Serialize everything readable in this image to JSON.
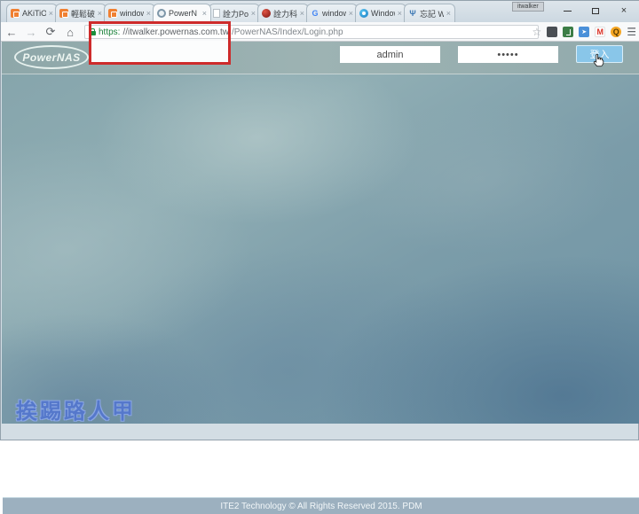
{
  "window": {
    "tooltip_label": "itwalker",
    "close_glyph": "×"
  },
  "glyphs": {
    "tab_close": "×",
    "back": "←",
    "forward": "→",
    "refresh": "⟳",
    "home": "⌂",
    "star": "☆",
    "menu": "☰",
    "gmail_m": "M",
    "q_letter": "Q",
    "google_g": "G",
    "trident": "Ψ"
  },
  "tabs": [
    {
      "title": "AKiTiO N",
      "icon": "xuite-orange"
    },
    {
      "title": "輕鬆破解",
      "icon": "xuite-orange"
    },
    {
      "title": "windows",
      "icon": "xuite-orange"
    },
    {
      "title": "PowerN",
      "icon": "powernas",
      "active": true
    },
    {
      "title": "詮力Pow",
      "icon": "blank-page"
    },
    {
      "title": "詮力科技",
      "icon": "red-sphere"
    },
    {
      "title": "windows",
      "icon": "google-g"
    },
    {
      "title": "Window",
      "icon": "blue-circle"
    },
    {
      "title": "忘記 Win",
      "icon": "trident"
    }
  ],
  "omnibox": {
    "scheme": "https:",
    "host": "//itwalker.powernas.com.tw",
    "path": "/PowerNAS/Index/Login.php"
  },
  "login_bar": {
    "logo": "PowerNAS",
    "username_value": "admin",
    "password_value": "•••••",
    "login_button": "登入"
  },
  "content": {
    "watermark": "挨踢路人甲",
    "footer": "ITE2 Technology © All Rights Reserved 2015. PDM"
  },
  "colors": {
    "accent_blue": "#89c6e9",
    "highlight_red": "#ce2b2b",
    "header_teal": "#93abad",
    "footer_teal": "#426785",
    "https_green": "#188038"
  }
}
